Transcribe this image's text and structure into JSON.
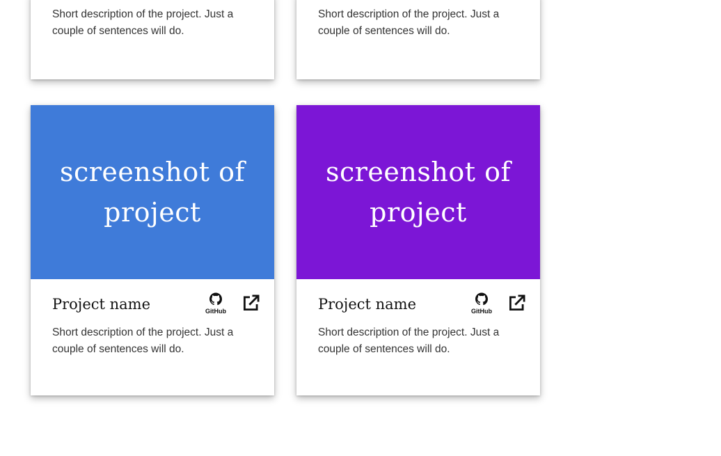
{
  "colors": {
    "blue_thumb": "#3f7bd9",
    "purple_thumb": "#7c16d6"
  },
  "cards": [
    {
      "description": "Short description of the project. Just a couple of sentences will do."
    },
    {
      "description": "Short description of the project. Just a couple of sentences will do."
    },
    {
      "thumbnail_text": "screenshot of project",
      "thumbnail_color": "#3f7bd9",
      "name": "Project name",
      "github_label": "GitHub",
      "description": "Short description of the project. Just a couple of sentences will do."
    },
    {
      "thumbnail_text": "screenshot of project",
      "thumbnail_color": "#7c16d6",
      "name": "Project name",
      "github_label": "GitHub",
      "description": "Short description of the project. Just a couple of sentences will do."
    }
  ]
}
